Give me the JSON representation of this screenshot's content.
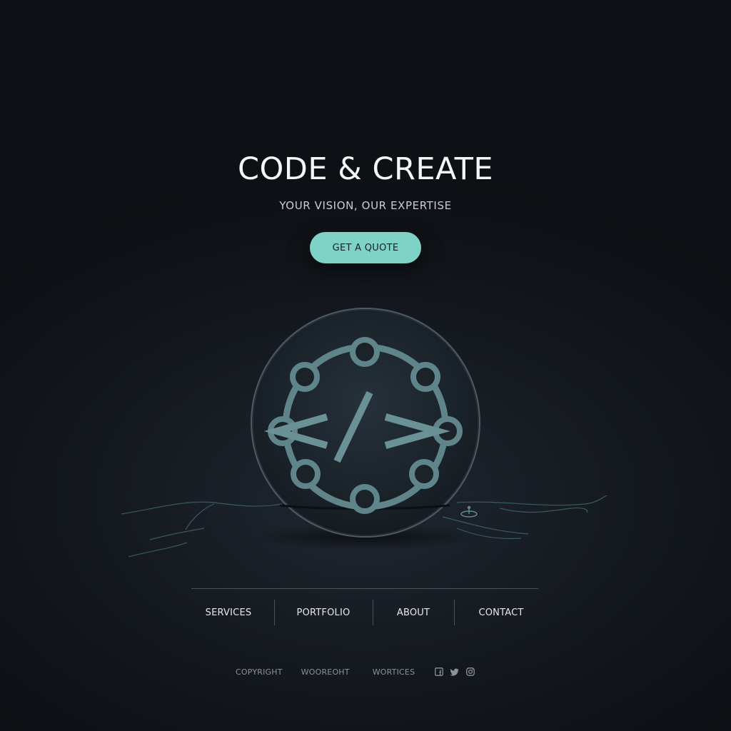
{
  "hero": {
    "title": "CODE & CREATE",
    "subtitle": "YOUR VISION, OUR EXPERTISE",
    "cta_label": "GET A QUOTE"
  },
  "logo": {
    "icon": "code-network-icon",
    "glyph_left": "<",
    "glyph_slash": "/",
    "glyph_right": ">"
  },
  "nav": {
    "items": [
      {
        "label": "SERVICES"
      },
      {
        "label": "PORTFOLIO"
      },
      {
        "label": "ABOUT"
      },
      {
        "label": "CONTACT"
      }
    ]
  },
  "footer": {
    "copyright": "COPYRIGHT",
    "text2": "WOOREOHT",
    "text3": "WORTICES",
    "social": [
      "facebook-icon",
      "twitter-icon",
      "instagram-icon"
    ]
  },
  "colors": {
    "background": "#0f1317",
    "accent": "#7fd3c6",
    "logo_stroke": "#5f858a",
    "text_primary": "#f4f6f7",
    "text_muted": "#8b939a"
  }
}
